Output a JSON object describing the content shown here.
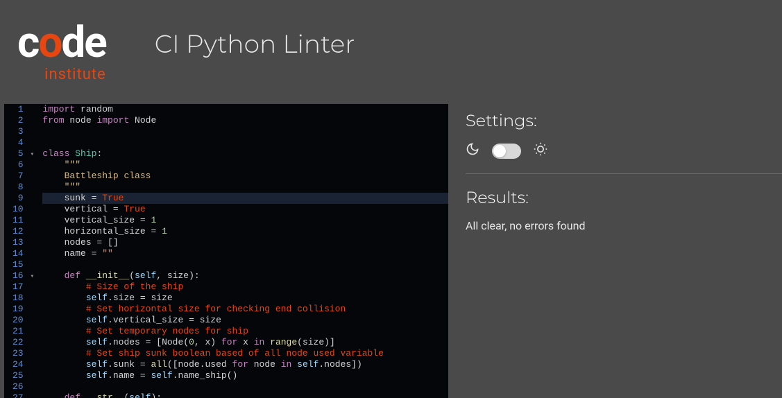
{
  "header": {
    "logo_parts": {
      "c": "c",
      "o": "o",
      "de": "de"
    },
    "logo_sub": "institute",
    "title": "CI Python Linter"
  },
  "sidebar": {
    "settings_heading": "Settings:",
    "results_heading": "Results:",
    "results_message": "All clear, no errors found"
  },
  "editor": {
    "highlighted_line": 9,
    "fold_lines": [
      5,
      16
    ],
    "lines": [
      [
        [
          "kw",
          "import"
        ],
        [
          "name",
          " random"
        ]
      ],
      [
        [
          "kw",
          "from"
        ],
        [
          "name",
          " node "
        ],
        [
          "kw",
          "import"
        ],
        [
          "name",
          " Node"
        ]
      ],
      [],
      [],
      [
        [
          "kw",
          "class"
        ],
        [
          "name",
          " "
        ],
        [
          "cls",
          "Ship"
        ],
        [
          "name",
          ":"
        ]
      ],
      [
        [
          "name",
          "    "
        ],
        [
          "yellow",
          "\"\"\""
        ]
      ],
      [
        [
          "name",
          "    "
        ],
        [
          "yellow",
          "Battleship class"
        ]
      ],
      [
        [
          "name",
          "    "
        ],
        [
          "yellow",
          "\"\"\""
        ]
      ],
      [
        [
          "name",
          "    sunk "
        ],
        [
          "op",
          "="
        ],
        [
          "name",
          " "
        ],
        [
          "bool",
          "True"
        ]
      ],
      [
        [
          "name",
          "    vertical "
        ],
        [
          "op",
          "="
        ],
        [
          "name",
          " "
        ],
        [
          "bool",
          "True"
        ]
      ],
      [
        [
          "name",
          "    vertical_size "
        ],
        [
          "op",
          "="
        ],
        [
          "name",
          " "
        ],
        [
          "num",
          "1"
        ]
      ],
      [
        [
          "name",
          "    horizontal_size "
        ],
        [
          "op",
          "="
        ],
        [
          "name",
          " "
        ],
        [
          "num",
          "1"
        ]
      ],
      [
        [
          "name",
          "    nodes "
        ],
        [
          "op",
          "="
        ],
        [
          "name",
          " []"
        ]
      ],
      [
        [
          "name",
          "    name "
        ],
        [
          "op",
          "="
        ],
        [
          "name",
          " "
        ],
        [
          "str",
          "\"\""
        ]
      ],
      [],
      [
        [
          "name",
          "    "
        ],
        [
          "kw",
          "def"
        ],
        [
          "name",
          " "
        ],
        [
          "def",
          "__init__"
        ],
        [
          "name",
          "("
        ],
        [
          "self",
          "self"
        ],
        [
          "name",
          ", size):"
        ]
      ],
      [
        [
          "name",
          "        "
        ],
        [
          "cmt",
          "# Size of the ship"
        ]
      ],
      [
        [
          "name",
          "        "
        ],
        [
          "self",
          "self"
        ],
        [
          "name",
          ".size "
        ],
        [
          "op",
          "="
        ],
        [
          "name",
          " size"
        ]
      ],
      [
        [
          "name",
          "        "
        ],
        [
          "cmt",
          "# Set horizontal size for checking end collision"
        ]
      ],
      [
        [
          "name",
          "        "
        ],
        [
          "self",
          "self"
        ],
        [
          "name",
          ".vertical_size "
        ],
        [
          "op",
          "="
        ],
        [
          "name",
          " size"
        ]
      ],
      [
        [
          "name",
          "        "
        ],
        [
          "cmt",
          "# Set temporary nodes for ship"
        ]
      ],
      [
        [
          "name",
          "        "
        ],
        [
          "self",
          "self"
        ],
        [
          "name",
          ".nodes "
        ],
        [
          "op",
          "="
        ],
        [
          "name",
          " [Node("
        ],
        [
          "num",
          "0"
        ],
        [
          "name",
          ", x) "
        ],
        [
          "kw",
          "for"
        ],
        [
          "name",
          " x "
        ],
        [
          "kw",
          "in"
        ],
        [
          "name",
          " "
        ],
        [
          "builtin",
          "range"
        ],
        [
          "name",
          "(size)]"
        ]
      ],
      [
        [
          "name",
          "        "
        ],
        [
          "cmt",
          "# Set ship sunk boolean based of all node used variable"
        ]
      ],
      [
        [
          "name",
          "        "
        ],
        [
          "self",
          "self"
        ],
        [
          "name",
          ".sunk "
        ],
        [
          "op",
          "="
        ],
        [
          "name",
          " "
        ],
        [
          "builtin",
          "all"
        ],
        [
          "name",
          "([node.used "
        ],
        [
          "kw",
          "for"
        ],
        [
          "name",
          " node "
        ],
        [
          "kw",
          "in"
        ],
        [
          "name",
          " "
        ],
        [
          "self",
          "self"
        ],
        [
          "name",
          ".nodes])"
        ]
      ],
      [
        [
          "name",
          "        "
        ],
        [
          "self",
          "self"
        ],
        [
          "name",
          ".name "
        ],
        [
          "op",
          "="
        ],
        [
          "name",
          " "
        ],
        [
          "self",
          "self"
        ],
        [
          "name",
          ".name_ship()"
        ]
      ],
      [],
      [
        [
          "name",
          "    "
        ],
        [
          "kw",
          "def"
        ],
        [
          "name",
          " "
        ],
        [
          "def",
          "__str__"
        ],
        [
          "name",
          "("
        ],
        [
          "self",
          "self"
        ],
        [
          "name",
          "):"
        ]
      ]
    ]
  }
}
